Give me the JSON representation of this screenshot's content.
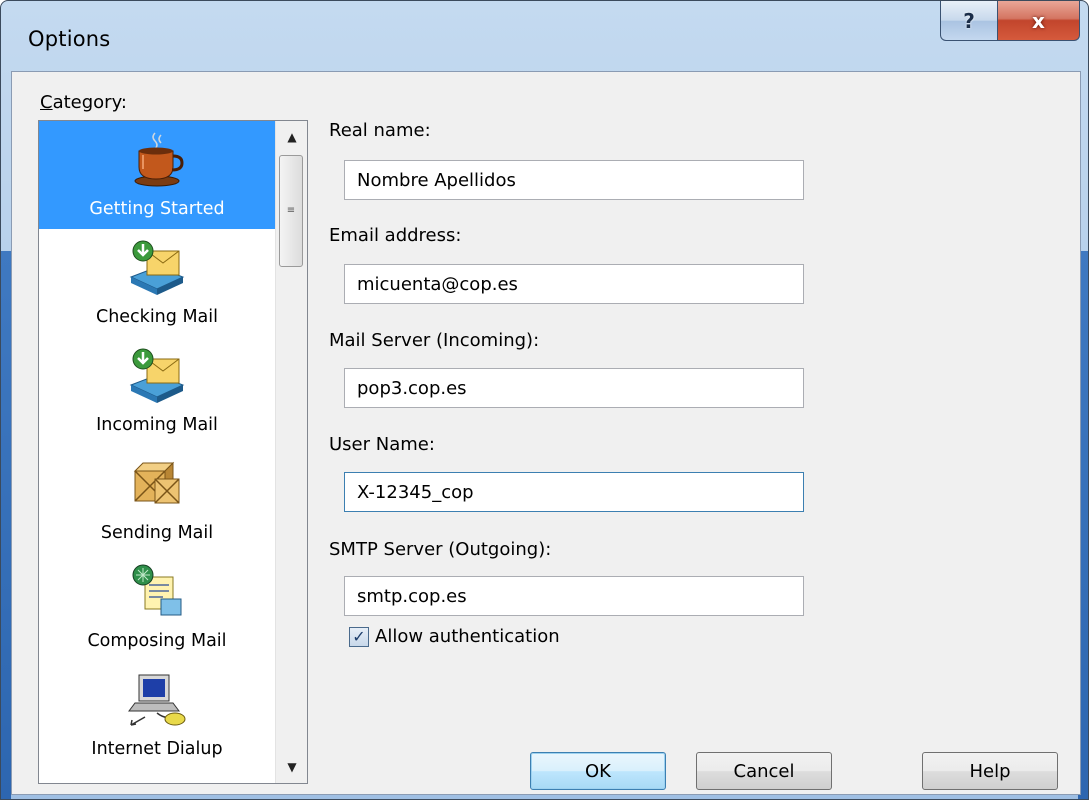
{
  "window": {
    "title": "Options",
    "help_glyph": "?",
    "close_glyph": "x"
  },
  "category": {
    "label": "Category:",
    "items": [
      {
        "label": "Getting Started",
        "icon": "coffee-cup-icon",
        "selected": true
      },
      {
        "label": "Checking Mail",
        "icon": "mail-download-icon",
        "selected": false
      },
      {
        "label": "Incoming Mail",
        "icon": "mail-incoming-icon",
        "selected": false
      },
      {
        "label": "Sending Mail",
        "icon": "packages-icon",
        "selected": false
      },
      {
        "label": "Composing Mail",
        "icon": "compose-mail-icon",
        "selected": false
      },
      {
        "label": "Internet Dialup",
        "icon": "dialup-computer-icon",
        "selected": false
      }
    ]
  },
  "fields": {
    "real_name": {
      "label": "Real name:",
      "value": "Nombre Apellidos"
    },
    "email": {
      "label": "Email address:",
      "value": "micuenta@cop.es"
    },
    "incoming": {
      "label": "Mail Server (Incoming):",
      "value": "pop3.cop.es"
    },
    "user_name": {
      "label": "User Name:",
      "value": "X-12345_cop"
    },
    "smtp": {
      "label": "SMTP Server (Outgoing):",
      "value": "smtp.cop.es"
    }
  },
  "auth": {
    "label": "Allow authentication",
    "checked": true
  },
  "buttons": {
    "ok": "OK",
    "cancel": "Cancel",
    "help": "Help"
  },
  "colors": {
    "selection": "#3399ff",
    "accent": "#3c7fb1"
  }
}
